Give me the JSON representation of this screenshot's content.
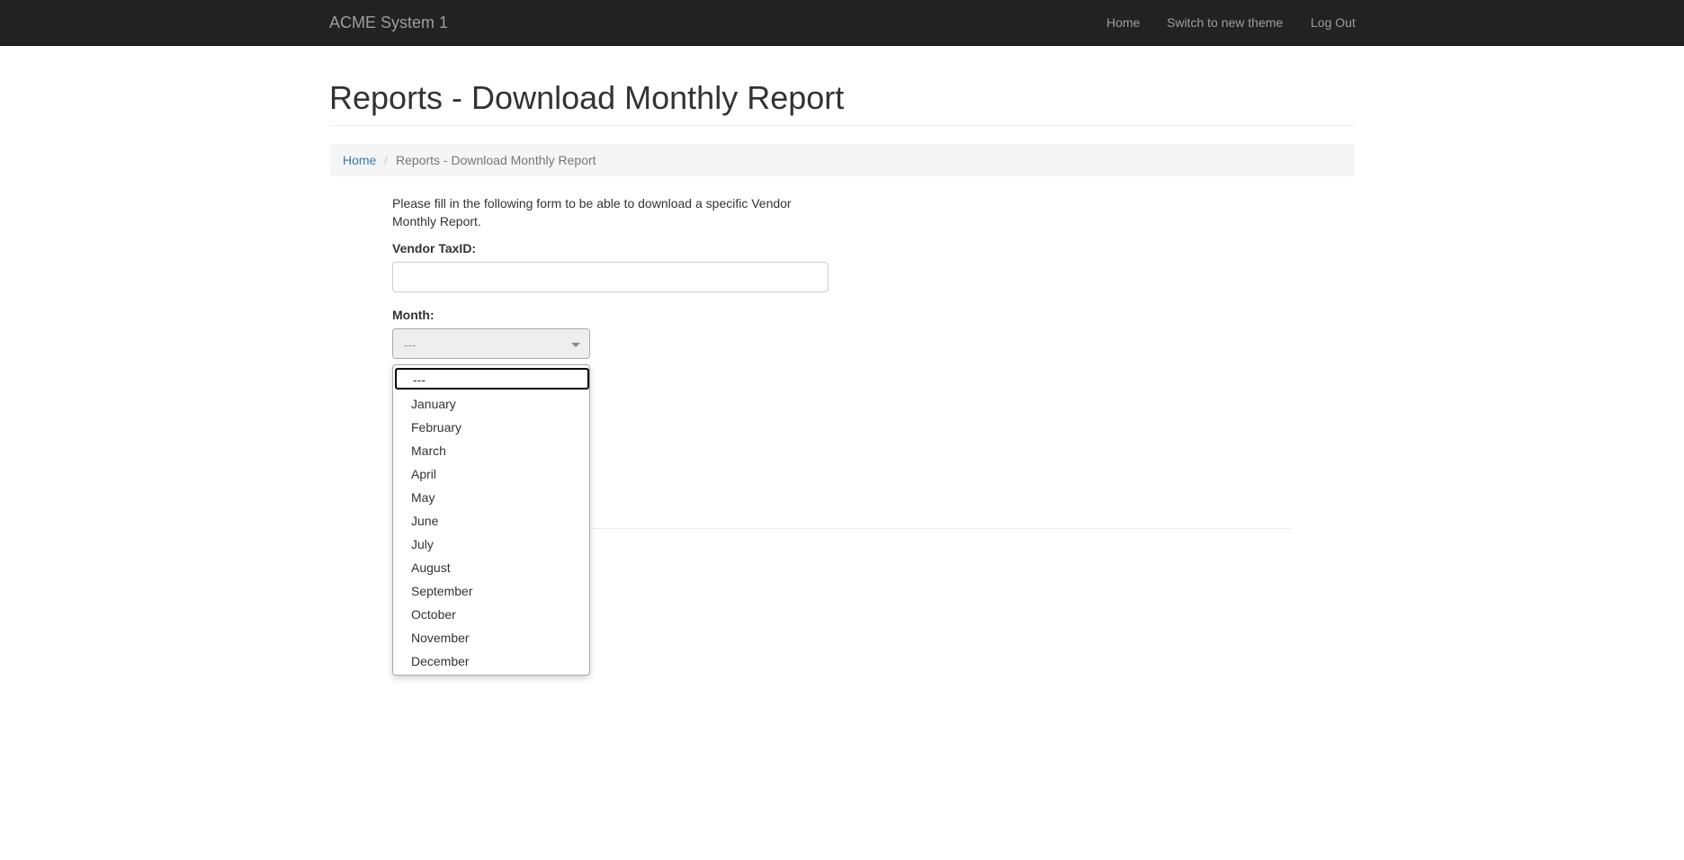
{
  "navbar": {
    "brand": "ACME System 1",
    "links": {
      "home": "Home",
      "switch_theme": "Switch to new theme",
      "logout": "Log Out"
    }
  },
  "page": {
    "title": "Reports - Download Monthly Report"
  },
  "breadcrumb": {
    "home": "Home",
    "separator": "/",
    "current": "Reports - Download Monthly Report"
  },
  "form": {
    "intro": "Please fill in the following form to be able to download a specific Vendor Monthly Report.",
    "vendor_label": "Vendor TaxID:",
    "vendor_value": "",
    "month_label": "Month:",
    "month_selected": "---",
    "month_options": [
      "---",
      "January",
      "February",
      "March",
      "April",
      "May",
      "June",
      "July",
      "August",
      "September",
      "October",
      "November",
      "December"
    ]
  },
  "colors": {
    "navbar_bg": "#222222",
    "nav_text": "#9d9d9d",
    "link": "#337ab7",
    "breadcrumb_bg": "#f5f5f5"
  }
}
